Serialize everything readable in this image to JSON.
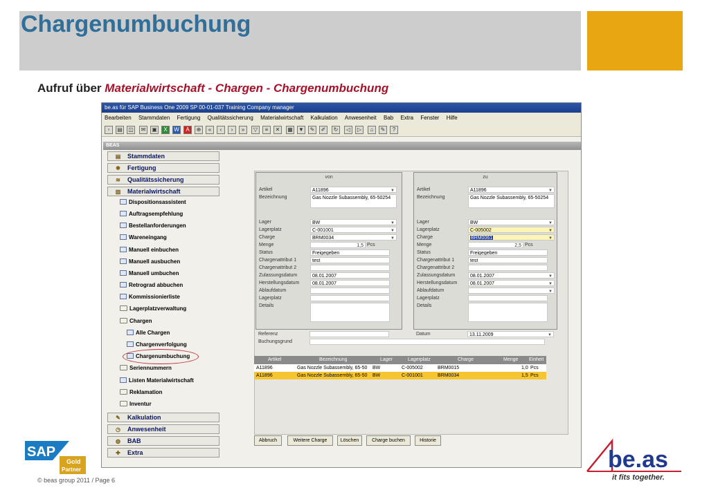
{
  "slide": {
    "title": "Chargenumbuchung",
    "subtitle_prefix": "Aufruf über ",
    "subtitle_path": "Materialwirtschaft - Chargen - Chargenumbuchung",
    "footer": "© beas group 2011 / Page 6",
    "accent_color": "#e8a711"
  },
  "window": {
    "title": "be.as für SAP Business One 2009 SP 00-01-037  Training Company  manager",
    "menu": [
      "Bearbeiten",
      "Stammdaten",
      "Fertigung",
      "Qualitätssicherung",
      "Materialwirtschaft",
      "Kalkulation",
      "Anwesenheit",
      "Bab",
      "Extra",
      "Fenster",
      "Hilfe"
    ],
    "beas_label": "BEAS"
  },
  "nav": {
    "main": [
      "Stammdaten",
      "Fertigung",
      "Qualitätssicherung",
      "Materialwirtschaft"
    ],
    "sub": [
      "Dispositionsassistent",
      "Auftragsempfehlung",
      "Bestellanforderungen",
      "Wareneingang",
      "Manuell einbuchen",
      "Manuell ausbuchen",
      "Manuell umbuchen",
      "Retrograd abbuchen",
      "Kommissionierliste",
      "Lagerplatzverwaltung",
      "Chargen"
    ],
    "chargen_sub": [
      "Alle Chargen",
      "Chargenverfolgung",
      "Chargenumbuchung"
    ],
    "sub2": [
      "Seriennummern",
      "Listen Materialwirtschaft",
      "Reklamation",
      "Inventur"
    ],
    "bottom": [
      "Kalkulation",
      "Anwesenheit",
      "BAB",
      "Extra"
    ]
  },
  "form": {
    "von_label": "von",
    "zu_label": "zu",
    "labels": {
      "artikel": "Artikel",
      "bezeichnung": "Bezeichnung",
      "lager": "Lager",
      "lagerplatz": "Lagerplatz",
      "charge": "Charge",
      "menge": "Menge",
      "status": "Status",
      "attr1": "Chargenattribut 1",
      "attr2": "Chargenattribut 2",
      "zulassung": "Zulassungsdatum",
      "herstellung": "Herstellungsdatum",
      "ablauf": "Ablaufdatum",
      "lagerplatz2": "Lagerplatz",
      "details": "Details",
      "referenz": "Referenz",
      "buchungsgrund": "Buchungsgrund",
      "datum": "Datum"
    },
    "von": {
      "artikel": "A11896",
      "bezeichnung": "Gas Nozzle Subassembly, 65-50254",
      "lager": "BW",
      "lagerplatz": "C-001001",
      "charge": "BRM0034",
      "menge": "1,5",
      "unit": "Pcs",
      "status": "Freigegeben",
      "attr1": "test",
      "zulassung": "08.01.2007",
      "herstellung": "08.01.2007"
    },
    "zu": {
      "artikel": "A11896",
      "bezeichnung": "Gas Nozzle Subassembly, 65-50254",
      "lager": "BW",
      "lagerplatz": "C-005002",
      "charge": "BRM0061",
      "menge": "2,5",
      "unit": "Pcs",
      "status": "Freigegeben",
      "attr1": "test",
      "zulassung": "08.01.2007",
      "herstellung": "08.01.2007"
    },
    "datum": "13.11.2009"
  },
  "table": {
    "headers": [
      "Artikel",
      "Bezeichnung",
      "Lager",
      "Lagerplatz",
      "Charge",
      "Menge",
      "Einheit"
    ],
    "rows": [
      [
        "A11896",
        "Gas Nozzle Subassembly, 65-50",
        "BW",
        "C-005002",
        "BRM0015",
        "1,0",
        "Pcs"
      ],
      [
        "A11896",
        "Gas Nozzle Subassembly, 65-50",
        "BW",
        "C-001001",
        "BRM0034",
        "1,5",
        "Pcs"
      ]
    ]
  },
  "buttons": [
    "Abbruch",
    "Weitere Charge",
    "Löschen",
    "Charge buchen",
    "Historie"
  ],
  "logos": {
    "sap": "SAP",
    "sap_badge_1": "Gold",
    "sap_badge_2": "Partner",
    "beas": "be.as",
    "beas_tagline": "it fits together."
  }
}
